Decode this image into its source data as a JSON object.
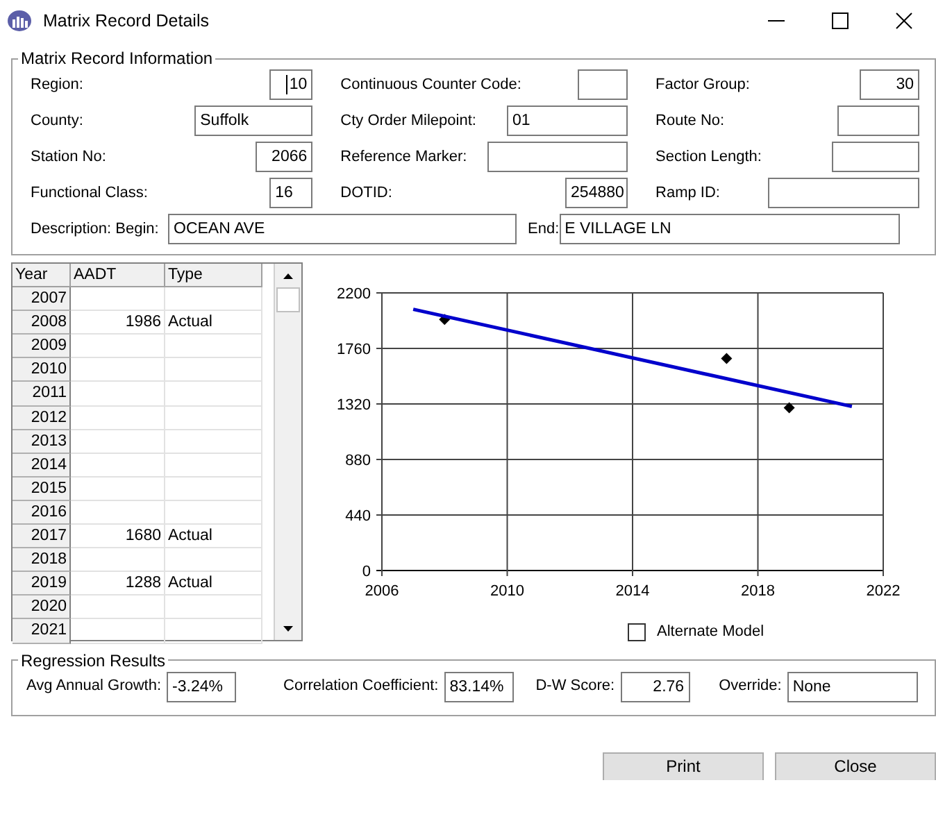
{
  "window": {
    "title": "Matrix Record Details"
  },
  "info": {
    "title": "Matrix Record Information",
    "fields": [
      {
        "label": "Region:",
        "value": "10",
        "focused": true
      },
      {
        "label": "Continuous Counter Code:",
        "focused": false
      },
      {
        "label": "Factor Group:",
        "value": "30",
        "focused": false
      },
      {
        "label": "County:",
        "value": "Suffolk",
        "focused": false
      },
      {
        "label": "Cty Order Milepoint:",
        "value": "01",
        "focused": false
      },
      {
        "label": "Route No:",
        "focused": false
      },
      {
        "label": "Station No:",
        "value": "2066",
        "focused": false
      },
      {
        "label": "Reference Marker:",
        "focused": false
      },
      {
        "label": "Section Length:",
        "focused": false
      },
      {
        "label": "Functional Class:",
        "value": "16",
        "focused": false
      },
      {
        "label": "DOTID:",
        "value": "254880",
        "focused": false
      },
      {
        "label": "Ramp ID:",
        "focused": false
      },
      {
        "label": "Description: Begin:",
        "value": "OCEAN AVE",
        "focused": false
      },
      {
        "label": "End:",
        "value": "E VILLAGE LN",
        "focused": false
      }
    ]
  },
  "table": {
    "columns": [
      "Year",
      "AADT",
      "Type"
    ],
    "rows": [
      {
        "year": "2007"
      },
      {
        "year": "2008",
        "aadt": "1986",
        "type": "Actual"
      },
      {
        "year": "2009"
      },
      {
        "year": "2010"
      },
      {
        "year": "2011"
      },
      {
        "year": "2012"
      },
      {
        "year": "2013"
      },
      {
        "year": "2014"
      },
      {
        "year": "2015"
      },
      {
        "year": "2016"
      },
      {
        "year": "2017",
        "aadt": "1680",
        "type": "Actual"
      },
      {
        "year": "2018"
      },
      {
        "year": "2019",
        "aadt": "1288",
        "type": "Actual"
      },
      {
        "year": "2020"
      },
      {
        "year": "2021"
      }
    ]
  },
  "chart": {
    "chart_data": {
      "type": "scatter",
      "x": [
        2007,
        2008,
        2017,
        2019,
        2021
      ],
      "series": [
        {
          "type": "scatter",
          "color": "#000000",
          "values": [
            null,
            1990,
            1680,
            1290,
            null
          ]
        },
        {
          "type": "line",
          "color": "#0000cc",
          "values": [
            2070,
            null,
            null,
            null,
            1300
          ]
        }
      ],
      "xlim": [
        2006,
        2022
      ],
      "ylim": [
        0,
        2200
      ],
      "xticks": [
        2006,
        2010,
        2014,
        2018,
        2022
      ],
      "yticks": [
        0,
        440,
        880,
        1320,
        1760,
        2200
      ],
      "grid": true
    }
  },
  "alternate_model": {
    "label": "Alternate Model",
    "checked": false
  },
  "regression": {
    "title": "Regression Results",
    "fields": [
      {
        "label": "Avg Annual Growth:",
        "value": "-3.24%"
      },
      {
        "label": "Correlation Coefficient:",
        "value": "83.14%"
      },
      {
        "label": "D-W Score:",
        "value": "2.76"
      },
      {
        "label": "Override:",
        "value": "None"
      }
    ]
  },
  "buttons": [
    "Print",
    "Close"
  ]
}
